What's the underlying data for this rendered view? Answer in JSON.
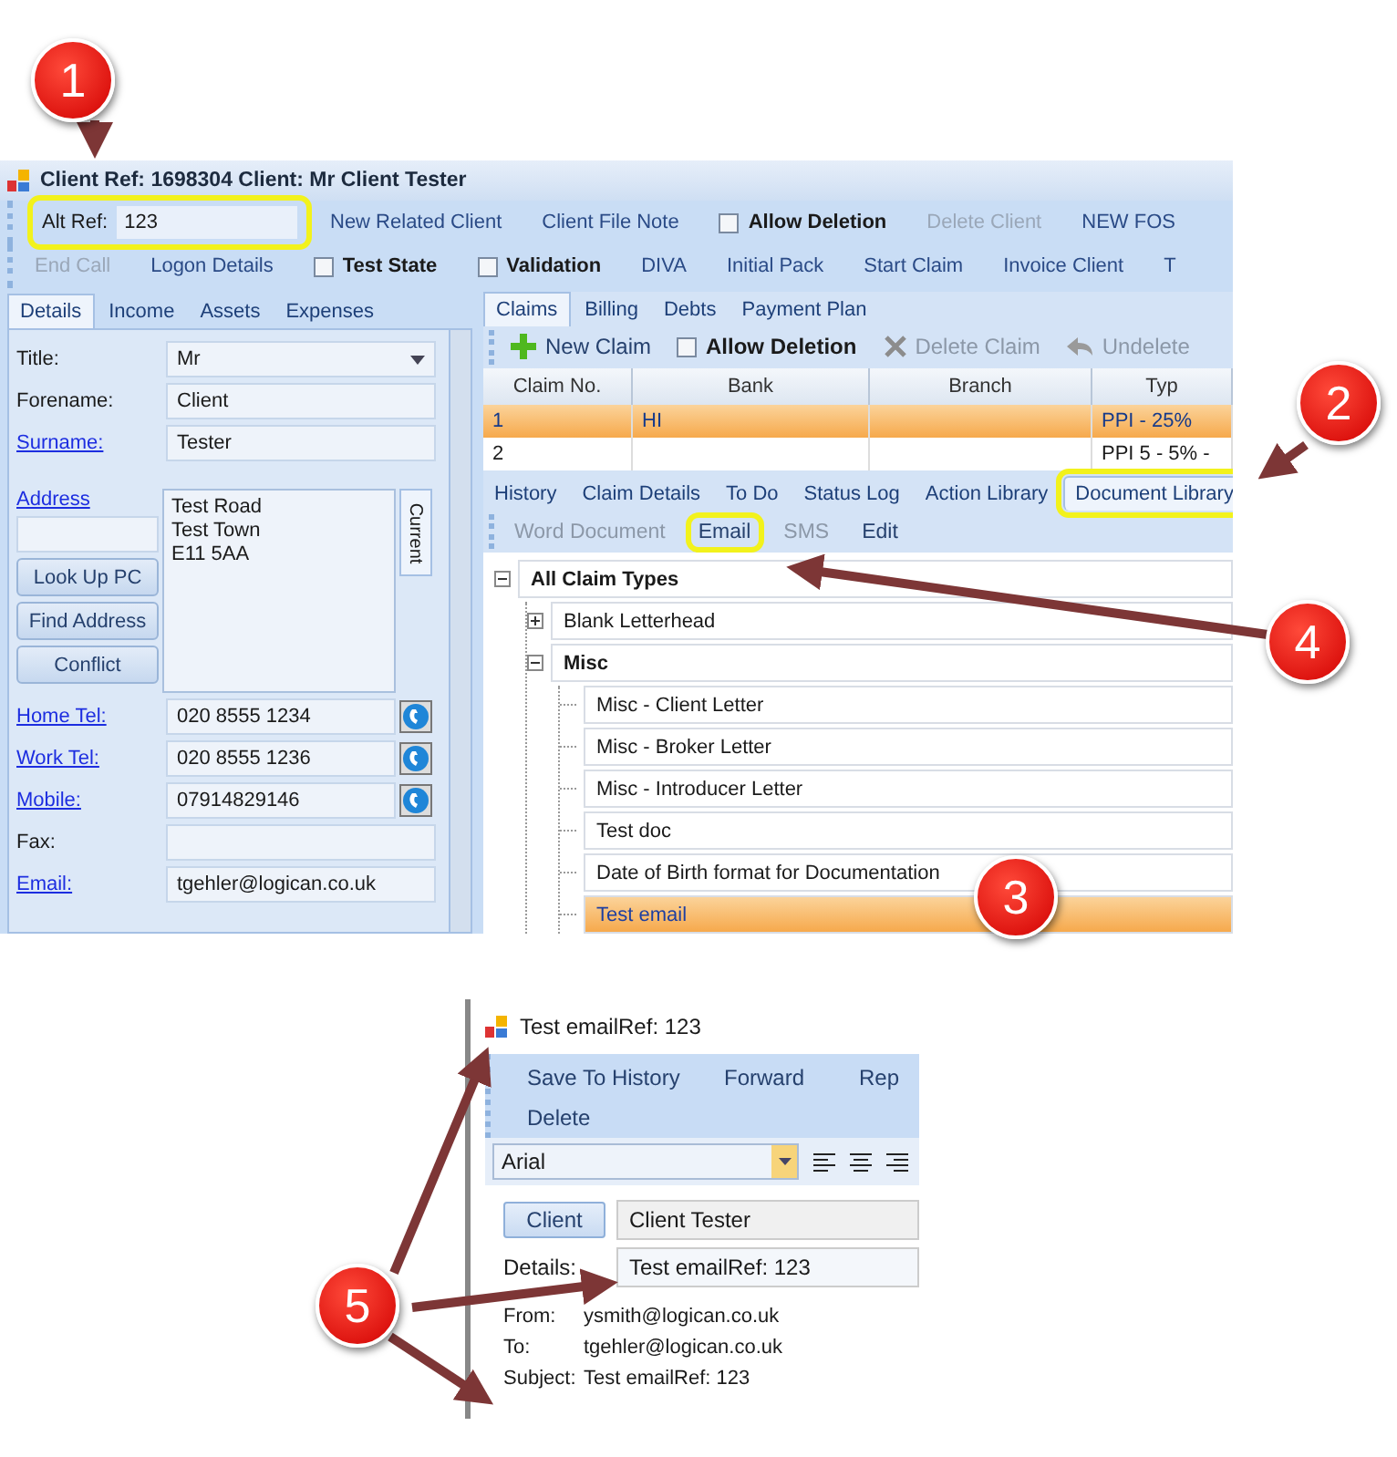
{
  "client_window": {
    "title": "Client Ref: 1698304 Client: Mr Client Tester",
    "alt_ref": {
      "label": "Alt Ref:",
      "value": "123",
      "highlighted": true
    },
    "toolbar_rows": [
      [
        {
          "kind": "link",
          "label": "New Related Client",
          "disabled": false
        },
        {
          "kind": "link",
          "label": "Client File Note",
          "disabled": false
        },
        {
          "kind": "checkbox",
          "label": "Allow Deletion",
          "checked": false
        },
        {
          "kind": "link",
          "label": "Delete Client",
          "disabled": true
        },
        {
          "kind": "link",
          "label": "NEW FOS",
          "disabled": false
        }
      ],
      [
        {
          "kind": "link",
          "label": "End Call",
          "disabled": true
        },
        {
          "kind": "link",
          "label": "Logon Details",
          "disabled": false
        },
        {
          "kind": "checkbox",
          "label": "Test State",
          "checked": false
        },
        {
          "kind": "checkbox",
          "label": "Validation",
          "checked": false
        },
        {
          "kind": "link",
          "label": "DIVA",
          "disabled": false
        },
        {
          "kind": "link",
          "label": "Initial Pack",
          "disabled": false
        },
        {
          "kind": "link",
          "label": "Start Claim",
          "disabled": false
        },
        {
          "kind": "link",
          "label": "Invoice Client",
          "disabled": false
        },
        {
          "kind": "link",
          "label": "T",
          "disabled": false
        }
      ]
    ],
    "left_tabs": [
      {
        "label": "Details",
        "selected": true
      },
      {
        "label": "Income",
        "selected": false
      },
      {
        "label": "Assets",
        "selected": false
      },
      {
        "label": "Expenses",
        "selected": false
      }
    ],
    "fields": [
      {
        "kind": "select",
        "label": "Title:",
        "link": false,
        "value": "Mr"
      },
      {
        "kind": "text",
        "label": "Forename:",
        "link": false,
        "value": "Client"
      },
      {
        "kind": "text",
        "label": "Surname:",
        "link": true,
        "value": "Tester"
      }
    ],
    "address": {
      "label": "Address",
      "lines": [
        "Test Road",
        "Test Town",
        "E11 5AA"
      ],
      "tab": "Current",
      "buttons": [
        "Look Up PC",
        "Find Address",
        "Conflict"
      ]
    },
    "contacts": [
      {
        "kind": "phone",
        "label": "Home Tel:",
        "link": true,
        "value": "020 8555 1234"
      },
      {
        "kind": "phone",
        "label": "Work Tel:",
        "link": true,
        "value": "020 8555 1236"
      },
      {
        "kind": "phone",
        "label": "Mobile:",
        "link": true,
        "value": "07914829146"
      },
      {
        "kind": "text",
        "label": "Fax:",
        "link": false
      },
      {
        "kind": "text",
        "label": "Email:",
        "link": true,
        "value": "tgehler@logican.co.uk"
      }
    ],
    "claim_tabs": [
      {
        "label": "Claims",
        "selected": true
      },
      {
        "label": "Billing",
        "selected": false
      },
      {
        "label": "Debts",
        "selected": false
      },
      {
        "label": "Payment Plan",
        "selected": false
      }
    ],
    "claim_toolbar": [
      {
        "kind": "add",
        "label": "New Claim",
        "disabled": false
      },
      {
        "kind": "checkbox",
        "label": "Allow Deletion",
        "checked": false
      },
      {
        "kind": "delete",
        "label": "Delete Claim",
        "disabled": true
      },
      {
        "kind": "undo",
        "label": "Undelete",
        "disabled": true
      }
    ],
    "claim_columns": [
      "Claim No.",
      "Bank",
      "Branch",
      "Typ"
    ],
    "claim_rows": [
      {
        "cells": [
          "1",
          "HI",
          "",
          "PPI - 25%"
        ],
        "selected": true
      },
      {
        "cells": [
          "2",
          "",
          "",
          "PPI 5 - 5% -"
        ],
        "selected": false
      }
    ],
    "detail_tabs": [
      {
        "label": "History",
        "selected": false,
        "highlighted": false
      },
      {
        "label": "Claim Details",
        "selected": false,
        "highlighted": false
      },
      {
        "label": "To Do",
        "selected": false,
        "highlighted": false
      },
      {
        "label": "Status Log",
        "selected": false,
        "highlighted": false
      },
      {
        "label": "Action Library",
        "selected": false,
        "highlighted": false
      },
      {
        "label": "Document Library",
        "selected": true,
        "highlighted": true
      }
    ],
    "document_toolbar": [
      {
        "label": "Word Document",
        "disabled": true,
        "highlighted": false
      },
      {
        "label": "Email",
        "disabled": false,
        "highlighted": true
      },
      {
        "label": "SMS",
        "disabled": true,
        "highlighted": false
      },
      {
        "label": "Edit",
        "disabled": false,
        "highlighted": false
      }
    ],
    "document_tree": [
      {
        "label": "All Claim Types",
        "expanded": true,
        "children": [
          {
            "label": "Blank Letterhead",
            "expanded": false
          },
          {
            "label": "Misc",
            "expanded": true,
            "children": [
              {
                "label": "Misc  - Client Letter",
                "selected": false
              },
              {
                "label": "Misc - Broker Letter",
                "selected": false
              },
              {
                "label": "Misc  - Introducer Letter",
                "selected": false
              },
              {
                "label": "Test doc",
                "selected": false
              },
              {
                "label": "Date of Birth format for Documentation",
                "selected": false
              },
              {
                "label": "Test email",
                "selected": true
              }
            ]
          }
        ]
      }
    ]
  },
  "email_window": {
    "title": "Test emailRef: 123",
    "toolbar": [
      "Save To History",
      "Forward",
      "Rep",
      "Delete"
    ],
    "font": "Arial",
    "client_button": "Client",
    "client_value": "Client Tester",
    "details_label": "Details:",
    "details_value": "Test emailRef: 123",
    "headers": [
      {
        "label": "From:",
        "value": "ysmith@logican.co.uk"
      },
      {
        "label": "To:",
        "value": "tgehler@logican.co.uk"
      },
      {
        "label": "Subject:",
        "value": "Test emailRef: 123"
      }
    ]
  },
  "callouts": [
    "1",
    "2",
    "3",
    "4",
    "5"
  ]
}
